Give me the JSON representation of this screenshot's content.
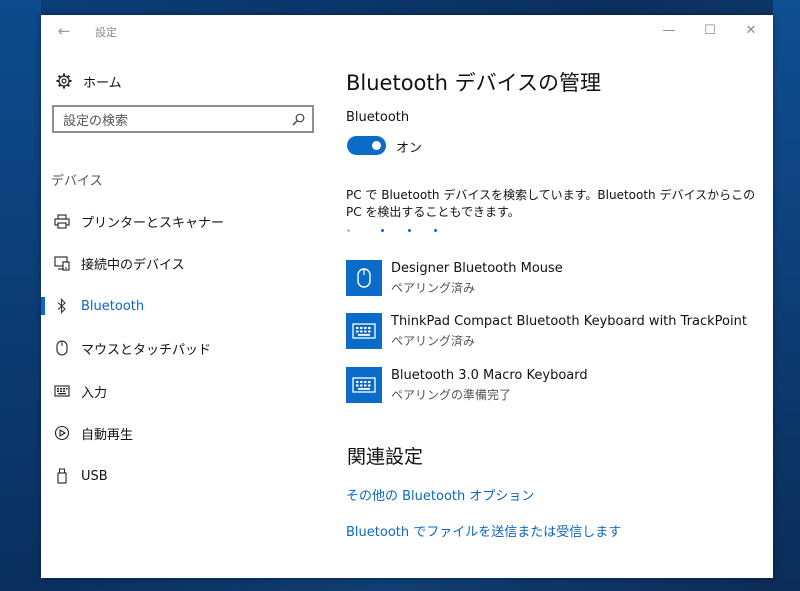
{
  "window": {
    "title": "設定",
    "back_glyph": "←",
    "minimize_glyph": "—",
    "maximize_glyph": "☐",
    "close_glyph": "✕"
  },
  "sidebar": {
    "home_label": "ホーム",
    "search_placeholder": "設定の検索",
    "section_heading": "デバイス",
    "items": [
      {
        "label": "プリンターとスキャナー",
        "icon": "printer-icon",
        "active": false
      },
      {
        "label": "接続中のデバイス",
        "icon": "connected-devices-icon",
        "active": false
      },
      {
        "label": "Bluetooth",
        "icon": "bluetooth-icon",
        "active": true
      },
      {
        "label": "マウスとタッチパッド",
        "icon": "mouse-icon",
        "active": false
      },
      {
        "label": "入力",
        "icon": "keyboard-icon",
        "active": false
      },
      {
        "label": "自動再生",
        "icon": "autoplay-icon",
        "active": false
      },
      {
        "label": "USB",
        "icon": "usb-icon",
        "active": false
      }
    ]
  },
  "main": {
    "title": "Bluetooth デバイスの管理",
    "bluetooth_label": "Bluetooth",
    "toggle_state": "オン",
    "description": "PC で Bluetooth デバイスを検索しています。Bluetooth デバイスからこの PC を検出することもできます。",
    "devices": [
      {
        "name": "Designer Bluetooth Mouse",
        "status": "ペアリング済み",
        "icon": "mouse-icon"
      },
      {
        "name": "ThinkPad Compact Bluetooth Keyboard with TrackPoint",
        "status": "ペアリング済み",
        "icon": "keyboard-icon"
      },
      {
        "name": "Bluetooth 3.0 Macro Keyboard",
        "status": "ペアリングの準備完了",
        "icon": "keyboard-icon"
      }
    ],
    "related_title": "関連設定",
    "links": [
      "その他の Bluetooth オプション",
      "Bluetooth でファイルを送信または受信します"
    ]
  },
  "colors": {
    "accent": "#0a6cc8",
    "link": "#0a68c2",
    "desktop": "#0b3f7a"
  }
}
